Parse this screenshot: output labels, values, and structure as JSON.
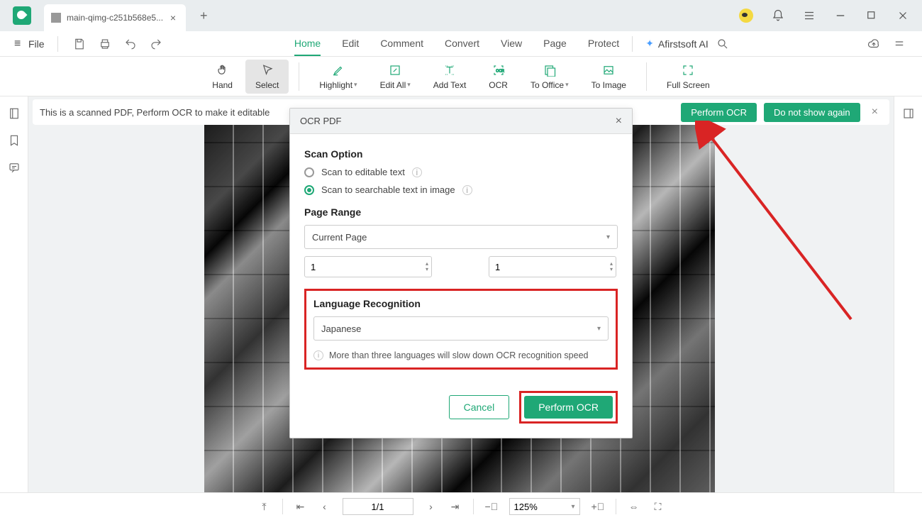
{
  "titlebar": {
    "tab_title": "main-qimg-c251b568e5..."
  },
  "menubar": {
    "file": "File",
    "tabs": [
      "Home",
      "Edit",
      "Comment",
      "Convert",
      "View",
      "Page",
      "Protect"
    ],
    "active_tab_index": 0,
    "ai": "Afirstsoft AI"
  },
  "toolbar": {
    "hand": "Hand",
    "select": "Select",
    "highlight": "Highlight",
    "edit_all": "Edit All",
    "add_text": "Add Text",
    "ocr": "OCR",
    "to_office": "To Office",
    "to_image": "To Image",
    "full_screen": "Full Screen"
  },
  "banner": {
    "text": "This is a scanned PDF, Perform OCR to make it editable",
    "perform": "Perform OCR",
    "dont_show": "Do not show again"
  },
  "dialog": {
    "title": "OCR PDF",
    "scan_option_label": "Scan Option",
    "opt_editable": "Scan to editable text",
    "opt_searchable": "Scan to searchable text in image",
    "page_range_label": "Page Range",
    "page_range_value": "Current Page",
    "from": "1",
    "to": "1",
    "lang_label": "Language Recognition",
    "lang_value": "Japanese",
    "lang_note": "More than three languages will slow down OCR recognition speed",
    "cancel": "Cancel",
    "perform": "Perform OCR"
  },
  "statusbar": {
    "page": "1/1",
    "zoom": "125%"
  }
}
